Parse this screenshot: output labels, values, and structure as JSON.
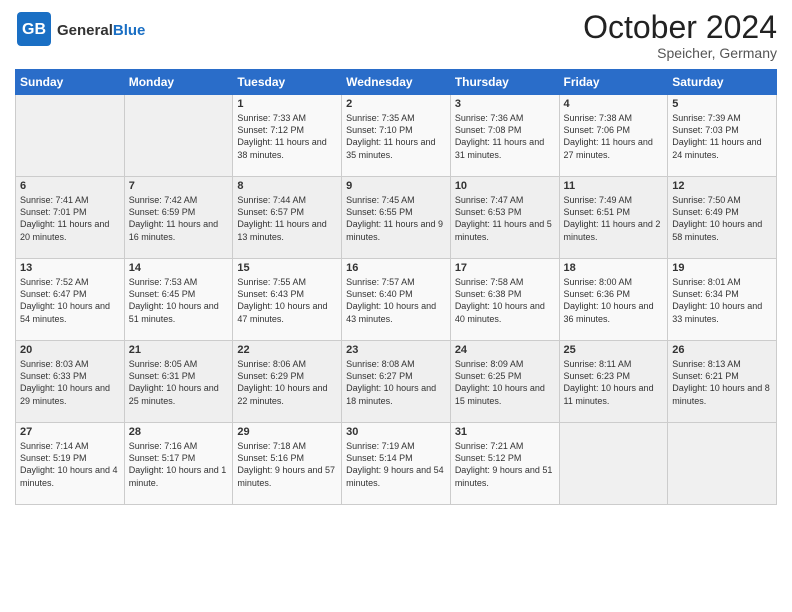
{
  "header": {
    "logo_general": "General",
    "logo_blue": "Blue",
    "month_title": "October 2024",
    "location": "Speicher, Germany"
  },
  "weekdays": [
    "Sunday",
    "Monday",
    "Tuesday",
    "Wednesday",
    "Thursday",
    "Friday",
    "Saturday"
  ],
  "weeks": [
    [
      {
        "day": "",
        "empty": true
      },
      {
        "day": "",
        "empty": true
      },
      {
        "day": "1",
        "sunrise": "Sunrise: 7:33 AM",
        "sunset": "Sunset: 7:12 PM",
        "daylight": "Daylight: 11 hours and 38 minutes."
      },
      {
        "day": "2",
        "sunrise": "Sunrise: 7:35 AM",
        "sunset": "Sunset: 7:10 PM",
        "daylight": "Daylight: 11 hours and 35 minutes."
      },
      {
        "day": "3",
        "sunrise": "Sunrise: 7:36 AM",
        "sunset": "Sunset: 7:08 PM",
        "daylight": "Daylight: 11 hours and 31 minutes."
      },
      {
        "day": "4",
        "sunrise": "Sunrise: 7:38 AM",
        "sunset": "Sunset: 7:06 PM",
        "daylight": "Daylight: 11 hours and 27 minutes."
      },
      {
        "day": "5",
        "sunrise": "Sunrise: 7:39 AM",
        "sunset": "Sunset: 7:03 PM",
        "daylight": "Daylight: 11 hours and 24 minutes."
      }
    ],
    [
      {
        "day": "6",
        "sunrise": "Sunrise: 7:41 AM",
        "sunset": "Sunset: 7:01 PM",
        "daylight": "Daylight: 11 hours and 20 minutes."
      },
      {
        "day": "7",
        "sunrise": "Sunrise: 7:42 AM",
        "sunset": "Sunset: 6:59 PM",
        "daylight": "Daylight: 11 hours and 16 minutes."
      },
      {
        "day": "8",
        "sunrise": "Sunrise: 7:44 AM",
        "sunset": "Sunset: 6:57 PM",
        "daylight": "Daylight: 11 hours and 13 minutes."
      },
      {
        "day": "9",
        "sunrise": "Sunrise: 7:45 AM",
        "sunset": "Sunset: 6:55 PM",
        "daylight": "Daylight: 11 hours and 9 minutes."
      },
      {
        "day": "10",
        "sunrise": "Sunrise: 7:47 AM",
        "sunset": "Sunset: 6:53 PM",
        "daylight": "Daylight: 11 hours and 5 minutes."
      },
      {
        "day": "11",
        "sunrise": "Sunrise: 7:49 AM",
        "sunset": "Sunset: 6:51 PM",
        "daylight": "Daylight: 11 hours and 2 minutes."
      },
      {
        "day": "12",
        "sunrise": "Sunrise: 7:50 AM",
        "sunset": "Sunset: 6:49 PM",
        "daylight": "Daylight: 10 hours and 58 minutes."
      }
    ],
    [
      {
        "day": "13",
        "sunrise": "Sunrise: 7:52 AM",
        "sunset": "Sunset: 6:47 PM",
        "daylight": "Daylight: 10 hours and 54 minutes."
      },
      {
        "day": "14",
        "sunrise": "Sunrise: 7:53 AM",
        "sunset": "Sunset: 6:45 PM",
        "daylight": "Daylight: 10 hours and 51 minutes."
      },
      {
        "day": "15",
        "sunrise": "Sunrise: 7:55 AM",
        "sunset": "Sunset: 6:43 PM",
        "daylight": "Daylight: 10 hours and 47 minutes."
      },
      {
        "day": "16",
        "sunrise": "Sunrise: 7:57 AM",
        "sunset": "Sunset: 6:40 PM",
        "daylight": "Daylight: 10 hours and 43 minutes."
      },
      {
        "day": "17",
        "sunrise": "Sunrise: 7:58 AM",
        "sunset": "Sunset: 6:38 PM",
        "daylight": "Daylight: 10 hours and 40 minutes."
      },
      {
        "day": "18",
        "sunrise": "Sunrise: 8:00 AM",
        "sunset": "Sunset: 6:36 PM",
        "daylight": "Daylight: 10 hours and 36 minutes."
      },
      {
        "day": "19",
        "sunrise": "Sunrise: 8:01 AM",
        "sunset": "Sunset: 6:34 PM",
        "daylight": "Daylight: 10 hours and 33 minutes."
      }
    ],
    [
      {
        "day": "20",
        "sunrise": "Sunrise: 8:03 AM",
        "sunset": "Sunset: 6:33 PM",
        "daylight": "Daylight: 10 hours and 29 minutes."
      },
      {
        "day": "21",
        "sunrise": "Sunrise: 8:05 AM",
        "sunset": "Sunset: 6:31 PM",
        "daylight": "Daylight: 10 hours and 25 minutes."
      },
      {
        "day": "22",
        "sunrise": "Sunrise: 8:06 AM",
        "sunset": "Sunset: 6:29 PM",
        "daylight": "Daylight: 10 hours and 22 minutes."
      },
      {
        "day": "23",
        "sunrise": "Sunrise: 8:08 AM",
        "sunset": "Sunset: 6:27 PM",
        "daylight": "Daylight: 10 hours and 18 minutes."
      },
      {
        "day": "24",
        "sunrise": "Sunrise: 8:09 AM",
        "sunset": "Sunset: 6:25 PM",
        "daylight": "Daylight: 10 hours and 15 minutes."
      },
      {
        "day": "25",
        "sunrise": "Sunrise: 8:11 AM",
        "sunset": "Sunset: 6:23 PM",
        "daylight": "Daylight: 10 hours and 11 minutes."
      },
      {
        "day": "26",
        "sunrise": "Sunrise: 8:13 AM",
        "sunset": "Sunset: 6:21 PM",
        "daylight": "Daylight: 10 hours and 8 minutes."
      }
    ],
    [
      {
        "day": "27",
        "sunrise": "Sunrise: 7:14 AM",
        "sunset": "Sunset: 5:19 PM",
        "daylight": "Daylight: 10 hours and 4 minutes."
      },
      {
        "day": "28",
        "sunrise": "Sunrise: 7:16 AM",
        "sunset": "Sunset: 5:17 PM",
        "daylight": "Daylight: 10 hours and 1 minute."
      },
      {
        "day": "29",
        "sunrise": "Sunrise: 7:18 AM",
        "sunset": "Sunset: 5:16 PM",
        "daylight": "Daylight: 9 hours and 57 minutes."
      },
      {
        "day": "30",
        "sunrise": "Sunrise: 7:19 AM",
        "sunset": "Sunset: 5:14 PM",
        "daylight": "Daylight: 9 hours and 54 minutes."
      },
      {
        "day": "31",
        "sunrise": "Sunrise: 7:21 AM",
        "sunset": "Sunset: 5:12 PM",
        "daylight": "Daylight: 9 hours and 51 minutes."
      },
      {
        "day": "",
        "empty": true
      },
      {
        "day": "",
        "empty": true
      }
    ]
  ]
}
